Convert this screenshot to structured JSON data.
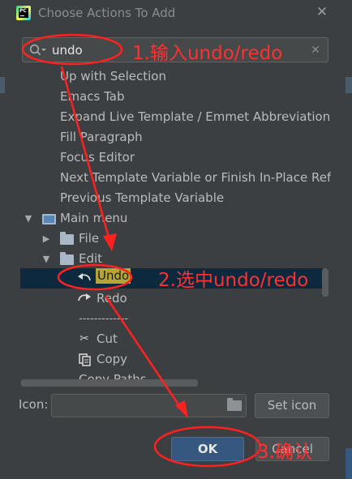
{
  "window": {
    "title": "Choose Actions To Add",
    "logo_text": "PC",
    "close_glyph": "✕"
  },
  "search": {
    "value": "undo",
    "clear_glyph": "✕"
  },
  "tree": {
    "items": [
      {
        "label": "Up with Selection"
      },
      {
        "label": "Emacs Tab"
      },
      {
        "label": "Expand Live Template / Emmet Abbreviation"
      },
      {
        "label": "Fill Paragraph"
      },
      {
        "label": "Focus Editor"
      },
      {
        "label": "Next Template Variable or Finish In-Place Refactoring"
      },
      {
        "label": "Previous Template Variable"
      },
      {
        "label": "Main menu"
      },
      {
        "label": "File"
      },
      {
        "label": "Edit"
      },
      {
        "label": "Undo"
      },
      {
        "label": "Redo"
      },
      {
        "label": "-------------"
      },
      {
        "label": "Cut"
      },
      {
        "label": "Copy"
      },
      {
        "label": "Copy Paths"
      }
    ]
  },
  "icon_field": {
    "label": "Icon:",
    "value": ""
  },
  "buttons": {
    "set_icon": "Set icon",
    "ok": "OK",
    "cancel": "Cancel"
  },
  "annotations": {
    "step1": "1.输入undo/redo",
    "step2": "2.选中undo/redo",
    "step3": "3.确认"
  },
  "icons": {
    "search": "search-icon",
    "undo": "undo-arrow-icon",
    "redo": "redo-arrow-icon",
    "cut": "scissors-icon",
    "copy": "copy-icon"
  },
  "colors": {
    "background": "#3c3f41",
    "selection": "#0d293e",
    "match_highlight": "#b5a534",
    "primary_button": "#365880",
    "annotation": "#ff3030"
  }
}
